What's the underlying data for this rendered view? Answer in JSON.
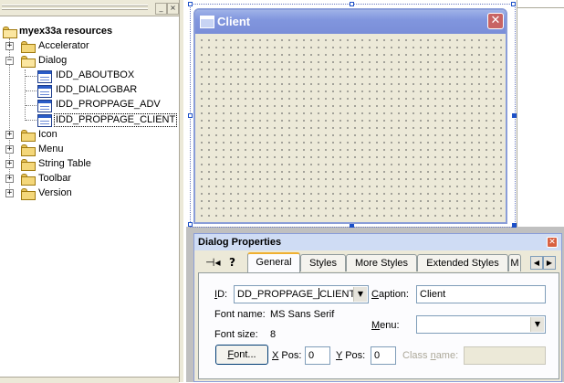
{
  "resource_tree": {
    "root_label": "myex33a resources",
    "items": [
      {
        "label": "Accelerator",
        "expander": "+"
      },
      {
        "label": "Dialog",
        "expander": "−"
      },
      {
        "label": "Icon",
        "expander": "+"
      },
      {
        "label": "Menu",
        "expander": "+"
      },
      {
        "label": "String Table",
        "expander": "+"
      },
      {
        "label": "Toolbar",
        "expander": "+"
      },
      {
        "label": "Version",
        "expander": "+"
      }
    ],
    "dialogs": [
      "IDD_ABOUTBOX",
      "IDD_DIALOGBAR",
      "IDD_PROPPAGE_ADV",
      "IDD_PROPPAGE_CLIENT"
    ],
    "selected": "IDD_PROPPAGE_CLIENT"
  },
  "left_pane_buttons": {
    "minimize": "_",
    "close": "×"
  },
  "client_dialog": {
    "title": "Client",
    "close_glyph": "✕"
  },
  "properties": {
    "title": "Dialog Properties",
    "close_glyph": "✕",
    "pin_glyph": "⊣◂",
    "help_glyph": "?",
    "tabs": [
      {
        "label": "General",
        "active": true
      },
      {
        "label": "Styles",
        "active": false
      },
      {
        "label": "More Styles",
        "active": false
      },
      {
        "label": "Extended Styles",
        "active": false
      },
      {
        "label": "M",
        "active": false
      }
    ],
    "id": {
      "label_pre": "",
      "label_u": "I",
      "label_post": "D:",
      "value_pre": "DD_PROPPAGE_",
      "value_post": "CLIENT"
    },
    "caption": {
      "label_u": "C",
      "label_post": "aption:",
      "value": "Client"
    },
    "font_name": {
      "label": "Font name:",
      "value": "MS Sans Serif"
    },
    "font_size": {
      "label": "Font size:",
      "value": "8"
    },
    "menu": {
      "label_u": "M",
      "label_post": "enu:",
      "value": ""
    },
    "font_button": {
      "label_u": "F",
      "label_post": "ont..."
    },
    "xpos": {
      "label_u": "X",
      "label_post": " Pos:",
      "value": "0"
    },
    "ypos": {
      "label_u": "Y",
      "label_post": " Pos:",
      "value": "0"
    },
    "class_name": {
      "label_pre": "Class ",
      "label_u": "n",
      "label_post": "ame:",
      "value": ""
    }
  },
  "colors": {
    "accent": "#7a8ed8",
    "selection_handle": "#1c50c8",
    "active_tab_highlight": "#f0b030"
  },
  "icons": {
    "folder": "folder-icon",
    "dialog": "dialog-resource-icon",
    "root": "resources-root-icon"
  }
}
